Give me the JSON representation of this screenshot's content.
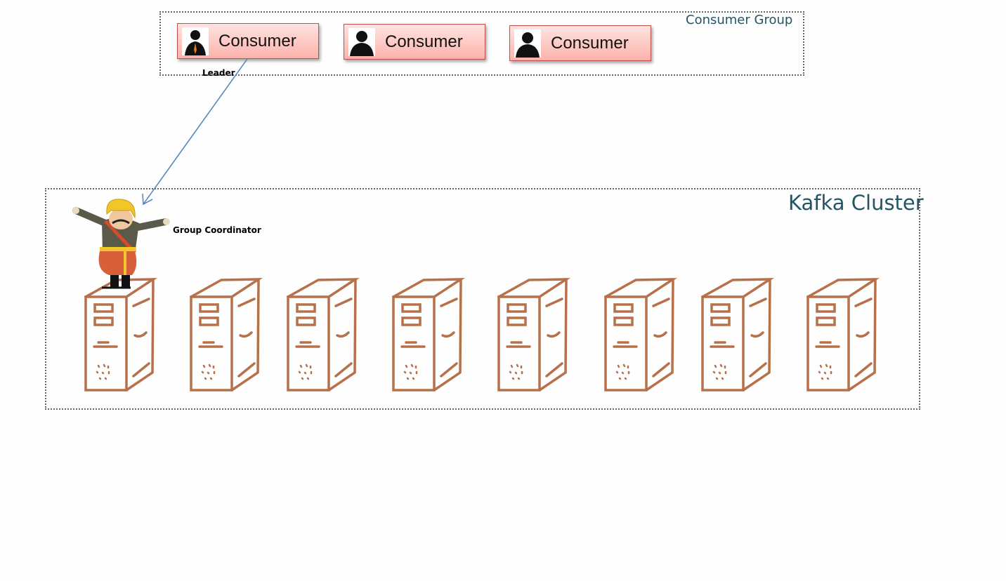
{
  "consumer_group": {
    "title": "Consumer Group",
    "consumers": [
      {
        "label": "Consumer",
        "role": "leader"
      },
      {
        "label": "Consumer"
      },
      {
        "label": "Consumer"
      }
    ],
    "leader_label": "Leader"
  },
  "kafka_cluster": {
    "title": "Kafka Cluster",
    "coordinator_label": "Group Coordinator",
    "broker_count": 8
  },
  "colors": {
    "arrow": "#4f81bd",
    "server": "#b8704a",
    "consumer_border": "#c0504d",
    "title": "#245566"
  }
}
